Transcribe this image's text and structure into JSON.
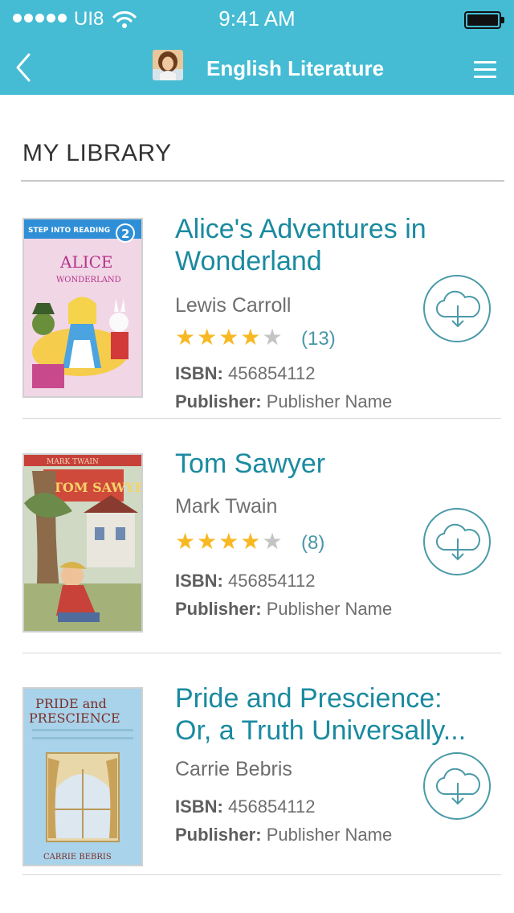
{
  "status_bar": {
    "carrier": "UI8",
    "time": "9:41 AM"
  },
  "nav": {
    "title": "English Literature"
  },
  "library": {
    "heading": "MY LIBRARY"
  },
  "labels": {
    "isbn": "ISBN:",
    "publisher": "Publisher:"
  },
  "books": [
    {
      "title_line1": "Alice's Adventures in",
      "title_line2": "Wonderland",
      "author": "Lewis Carroll",
      "rating": 4,
      "rating_count": "(13)",
      "isbn": "456854112",
      "publisher": "Publisher Name",
      "cover": {
        "top_text": "STEP INTO READING",
        "badge": "2",
        "title": "ALICE",
        "subtitle": "WONDERLAND"
      }
    },
    {
      "title_line1": "Tom Sawyer",
      "author": "Mark Twain",
      "rating": 4,
      "rating_count": "(8)",
      "isbn": "456854112",
      "publisher": "Publisher Name",
      "cover": {
        "top_text": "MARK TWAIN",
        "title": "TOM SAWYER"
      }
    },
    {
      "title_line1": "Pride and Prescience:",
      "title_line2": "Or, a  Truth Universally...",
      "author": "Carrie Bebris",
      "isbn": "456854112",
      "publisher": "Publisher Name",
      "cover": {
        "title_line1": "PRIDE and",
        "title_line2": "PRESCIENCE",
        "author": "CARRIE BEBRIS"
      }
    }
  ],
  "colors": {
    "header": "#45bcd4",
    "title_text": "#1a8aa0",
    "star_on": "#f7b822",
    "star_off": "#c4c4c4"
  },
  "icons": {
    "back": "chevron-left-icon",
    "menu": "hamburger-menu-icon",
    "download": "cloud-download-icon"
  }
}
